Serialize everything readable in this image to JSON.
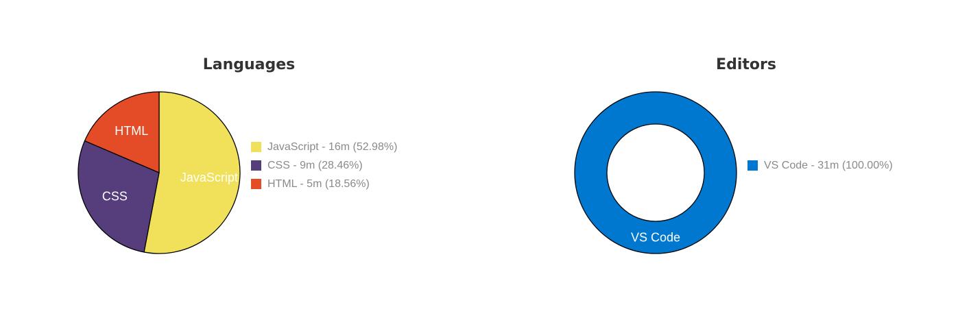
{
  "colors": {
    "javascript": "#f1e05a",
    "css": "#563d7c",
    "html": "#e34c26",
    "vscode": "#0078d0",
    "title": "#333333",
    "legend_text": "#8a8a8a"
  },
  "chart_data": [
    {
      "type": "pie",
      "title": "Languages",
      "slices": [
        {
          "label": "JavaScript",
          "value": 52.98,
          "legend": "JavaScript - 16m (52.98%)",
          "color": "#f1e05a"
        },
        {
          "label": "CSS",
          "value": 28.46,
          "legend": "CSS - 9m (28.46%)",
          "color": "#563d7c"
        },
        {
          "label": "HTML",
          "value": 18.56,
          "legend": "HTML - 5m (18.56%)",
          "color": "#e34c26"
        }
      ],
      "legend_position": "right"
    },
    {
      "type": "pie",
      "title": "Editors",
      "donut": true,
      "slices": [
        {
          "label": "VS Code",
          "value": 100.0,
          "legend": "VS Code - 31m (100.00%)",
          "color": "#0078d0"
        }
      ],
      "legend_position": "right"
    }
  ]
}
